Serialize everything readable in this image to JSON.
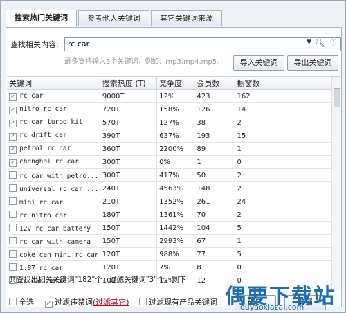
{
  "tabs": [
    {
      "label": "搜索热门关键词"
    },
    {
      "label": "参考他人关键词"
    },
    {
      "label": "其它关键词来源"
    }
  ],
  "search": {
    "label": "查找相关内容:",
    "value": "rc car",
    "hint": "最多支持输入3个关键词，例如：mp3,mp4,mp5。"
  },
  "buttons": {
    "import": "导入关键词",
    "export": "导出关键词"
  },
  "table": {
    "columns": [
      "关键词",
      "搜索热度 (T)",
      "竞争度",
      "会员数",
      "橱窗数"
    ],
    "rows": [
      {
        "keyword": "rc car",
        "heat": "9000T",
        "competition": "12%",
        "members": "423",
        "windows": "162",
        "checked": true
      },
      {
        "keyword": "nitro rc car",
        "heat": "720T",
        "competition": "158%",
        "members": "126",
        "windows": "14",
        "checked": true
      },
      {
        "keyword": "rc car turbo kit",
        "heat": "570T",
        "competition": "127%",
        "members": "38",
        "windows": "2",
        "checked": true
      },
      {
        "keyword": "rc drift car",
        "heat": "390T",
        "competition": "637%",
        "members": "193",
        "windows": "15",
        "checked": true
      },
      {
        "keyword": "petrol rc car",
        "heat": "360T",
        "competition": "2200%",
        "members": "89",
        "windows": "1",
        "checked": true
      },
      {
        "keyword": "chenghai rc car",
        "heat": "300T",
        "competition": "0%",
        "members": "1",
        "windows": "0",
        "checked": true
      },
      {
        "keyword": "rc car with petro...",
        "heat": "300T",
        "competition": "417%",
        "members": "50",
        "windows": "2",
        "checked": false
      },
      {
        "keyword": "universal rc car ...",
        "heat": "240T",
        "competition": "4563%",
        "members": "148",
        "windows": "2",
        "checked": false
      },
      {
        "keyword": "mini rc car",
        "heat": "210T",
        "competition": "1352%",
        "members": "261",
        "windows": "24",
        "checked": false
      },
      {
        "keyword": "rc nitro car",
        "heat": "180T",
        "competition": "1361%",
        "members": "70",
        "windows": "2",
        "checked": false
      },
      {
        "keyword": "12v rc car battery",
        "heat": "150T",
        "competition": "1442%",
        "members": "104",
        "windows": "5",
        "checked": false
      },
      {
        "keyword": "rc car with camera",
        "heat": "150T",
        "competition": "2993%",
        "members": "67",
        "windows": "1",
        "checked": false
      },
      {
        "keyword": "coke can mini rc car",
        "heat": "120T",
        "competition": "988%",
        "members": "77",
        "windows": "5",
        "checked": false
      },
      {
        "keyword": "1:87 rc car",
        "heat": "120T",
        "competition": "7%",
        "members": "8",
        "windows": "0",
        "checked": false
      },
      {
        "keyword": "rc car petrol",
        "heat": "100T",
        "competition": "12%",
        "members": "12",
        "windows": "0",
        "checked": false
      }
    ]
  },
  "status": "共查找出相关关键词\"182\"个，过滤关键词\"3\"个，剩下",
  "bottom": {
    "select_all": "全选",
    "filter_banned": "过滤违禁词",
    "filter_other": "(过滤其它)",
    "filter_existing": "过滤现有产品关键词",
    "ok": "确定",
    "cancel": "取消"
  },
  "watermark": {
    "title": "偶要下载站",
    "url": "ouyaoxiazai.com"
  }
}
